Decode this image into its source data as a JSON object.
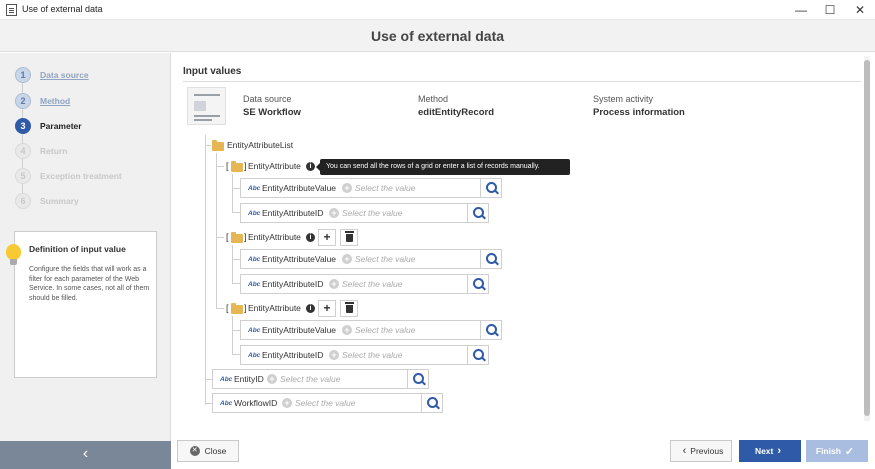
{
  "window": {
    "title": "Use of external data",
    "minimize": "—",
    "maximize": "☐",
    "close": "✕"
  },
  "header": {
    "title": "Use of external data"
  },
  "steps": [
    {
      "num": "1",
      "label": "Data source",
      "state": "done"
    },
    {
      "num": "2",
      "label": "Method",
      "state": "done"
    },
    {
      "num": "3",
      "label": "Parameter",
      "state": "current"
    },
    {
      "num": "4",
      "label": "Return",
      "state": "todo"
    },
    {
      "num": "5",
      "label": "Exception treatment",
      "state": "todo"
    },
    {
      "num": "6",
      "label": "Summary",
      "state": "todo"
    }
  ],
  "infobox": {
    "title": "Definition of input value",
    "text": "Configure the fields that will work as a filter for each parameter of the Web Service. In some cases, not all of them should be filled."
  },
  "main": {
    "section_title": "Input values",
    "data_source_label": "Data source",
    "data_source_value": "SE Workflow",
    "method_label": "Method",
    "method_value": "editEntityRecord",
    "activity_label": "System activity",
    "activity_value": "Process information"
  },
  "tree": {
    "list_label": "EntityAttributeList",
    "bracket_open": "[",
    "bracket_close": "]",
    "group_label": "EntityAttribute",
    "tooltip": "You can send all the rows of a grid or enter a list of records manually.",
    "abc": "Abc",
    "placeholder": "Select the value",
    "value_field": "EntityAttributeValue",
    "id_field": "EntityAttributeID",
    "entity_id": "EntityID",
    "workflow_id": "WorkflowID",
    "add": "+"
  },
  "footer": {
    "close": "Close",
    "previous": "Previous",
    "next": "Next",
    "finish": "Finish"
  },
  "icons": {
    "collapse": "‹",
    "prev_chevron": "‹",
    "next_chevron": "›",
    "check": "✓",
    "info": "i",
    "close_x": "✕"
  },
  "colors": {
    "accent": "#2f5aa8",
    "sidebar_bar": "#7a8799",
    "folder": "#e5b653"
  }
}
